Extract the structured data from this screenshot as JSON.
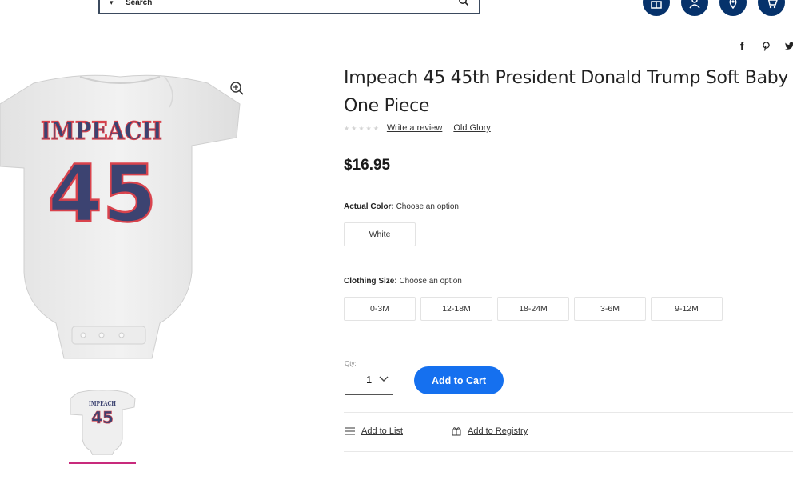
{
  "header": {
    "search": {
      "placeholder": "Search",
      "value": ""
    },
    "icons": [
      "services-icon",
      "account-icon",
      "location-icon",
      "cart-icon"
    ],
    "accent": "#06326b"
  },
  "share": {
    "icons": [
      "facebook-icon",
      "pinterest-icon",
      "twitter-icon"
    ]
  },
  "product": {
    "title": "Impeach 45 45th President Donald Trump Soft Baby One Piece",
    "write_review": "Write a review",
    "brand": "Old Glory",
    "price": "$16.95",
    "image_text": {
      "word": "IMPEACH",
      "number": "45"
    }
  },
  "options": {
    "color": {
      "label": "Actual Color:",
      "hint": "Choose an option",
      "values": [
        "White"
      ]
    },
    "size": {
      "label": "Clothing Size:",
      "hint": "Choose an option",
      "values": [
        "0-3M",
        "12-18M",
        "18-24M",
        "3-6M",
        "9-12M"
      ]
    }
  },
  "purchase": {
    "qty_label": "Qty:",
    "qty_value": "1",
    "add_to_cart": "Add to Cart",
    "add_to_list": "Add to List",
    "add_to_registry": "Add to Registry",
    "button_color": "#1570ef"
  }
}
